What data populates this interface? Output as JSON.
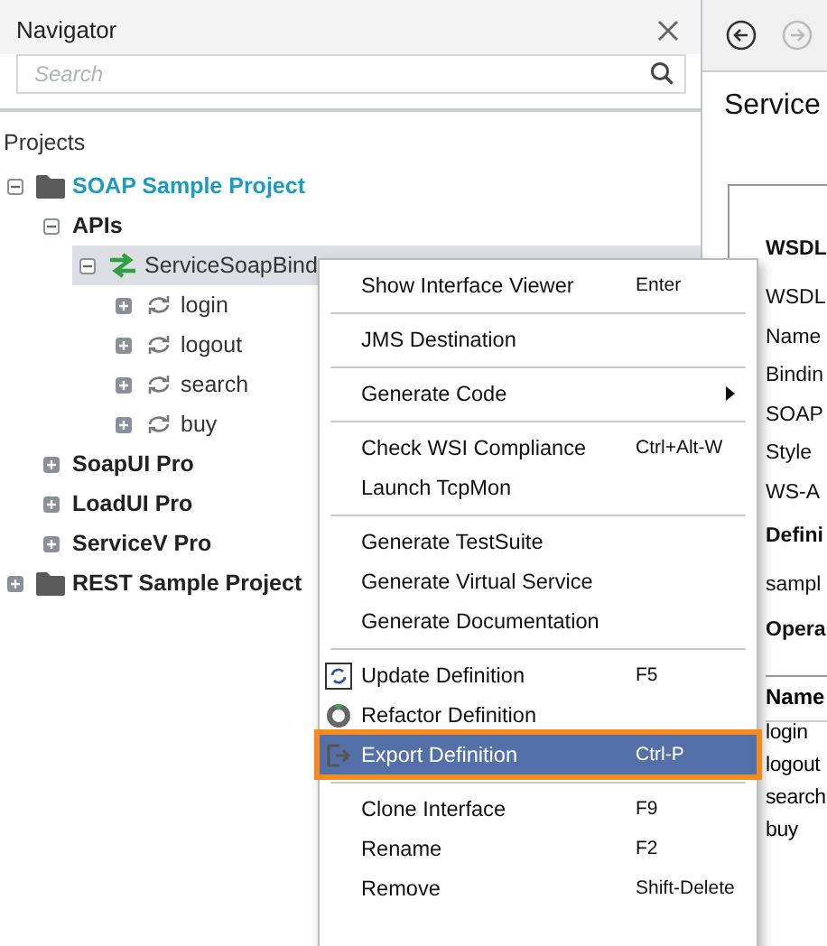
{
  "navigator": {
    "title": "Navigator",
    "search": {
      "placeholder": "Search"
    }
  },
  "projects_label": "Projects",
  "tree": [
    {
      "label": "SOAP Sample Project",
      "kind": "project",
      "expanded": true,
      "active": true,
      "children": [
        {
          "label": "APIs",
          "kind": "folder",
          "expanded": true,
          "children": [
            {
              "label": "ServiceSoapBind",
              "kind": "interface",
              "expanded": true,
              "selected": true,
              "children": [
                {
                  "label": "login",
                  "kind": "operation",
                  "expanded": false,
                  "selected": false
                },
                {
                  "label": "logout",
                  "kind": "operation",
                  "expanded": false,
                  "selected": false
                },
                {
                  "label": "search",
                  "kind": "operation",
                  "expanded": false,
                  "selected": false
                },
                {
                  "label": "buy",
                  "kind": "operation",
                  "expanded": false,
                  "selected": false
                }
              ]
            }
          ]
        },
        {
          "label": "SoapUI Pro",
          "kind": "folder",
          "expanded": false
        },
        {
          "label": "LoadUI Pro",
          "kind": "folder",
          "expanded": false
        },
        {
          "label": "ServiceV Pro",
          "kind": "folder",
          "expanded": false
        }
      ]
    },
    {
      "label": "REST Sample Project",
      "kind": "project",
      "expanded": false,
      "active": false
    }
  ],
  "editor": {
    "title": "Service",
    "labels": [
      {
        "text": "WSDL",
        "kind": "heading"
      },
      {
        "text": "WSDL",
        "kind": "field"
      },
      {
        "text": "Name",
        "kind": "field"
      },
      {
        "text": "Bindin",
        "kind": "field"
      },
      {
        "text": "SOAP",
        "kind": "field"
      },
      {
        "text": "Style",
        "kind": "field"
      },
      {
        "text": "WS-A",
        "kind": "field"
      },
      {
        "text": "Defini",
        "kind": "heading"
      },
      {
        "text": "sampl",
        "kind": "field"
      },
      {
        "text": "Opera",
        "kind": "heading"
      }
    ],
    "table": {
      "columns": [
        "Name"
      ],
      "rows": [
        "login",
        "logout",
        "search",
        "buy"
      ]
    }
  },
  "context_menu": [
    [
      {
        "label": "Show Interface Viewer",
        "shortcut": "Enter",
        "selected": false
      }
    ],
    [
      {
        "label": "JMS Destination",
        "selected": false
      }
    ],
    [
      {
        "label": "Generate Code",
        "submenu": true,
        "selected": false
      }
    ],
    [
      {
        "label": "Check WSI Compliance",
        "shortcut": "Ctrl+Alt-W",
        "selected": false
      },
      {
        "label": "Launch TcpMon",
        "selected": false
      }
    ],
    [
      {
        "label": "Generate TestSuite",
        "selected": false
      },
      {
        "label": "Generate Virtual Service",
        "selected": false
      },
      {
        "label": "Generate Documentation",
        "selected": false
      }
    ],
    [
      {
        "label": "Update Definition",
        "shortcut": "F5",
        "kind": "update",
        "selected": false
      },
      {
        "label": "Refactor Definition",
        "kind": "refactor",
        "selected": false
      },
      {
        "label": "Export Definition",
        "shortcut": "Ctrl-P",
        "kind": "export",
        "selected": true
      }
    ],
    [
      {
        "label": "Clone Interface",
        "shortcut": "F9",
        "selected": false
      },
      {
        "label": "Rename",
        "shortcut": "F2",
        "selected": false
      },
      {
        "label": "Remove",
        "shortcut": "Shift-Delete",
        "selected": false
      }
    ]
  ]
}
